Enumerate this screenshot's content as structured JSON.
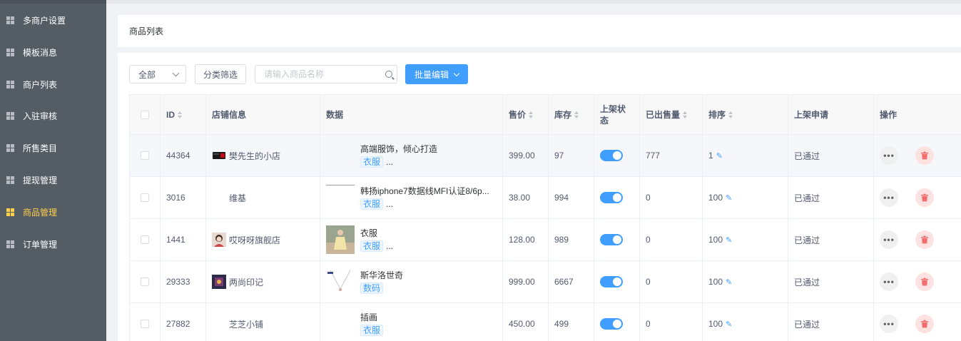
{
  "sidebar": {
    "items": [
      {
        "label": "多商户设置",
        "active": false
      },
      {
        "label": "模板消息",
        "active": false
      },
      {
        "label": "商户列表",
        "active": false
      },
      {
        "label": "入驻审核",
        "active": false
      },
      {
        "label": "所售类目",
        "active": false
      },
      {
        "label": "提现管理",
        "active": false
      },
      {
        "label": "商品管理",
        "active": true
      },
      {
        "label": "订单管理",
        "active": false
      }
    ]
  },
  "page": {
    "title": "商品列表"
  },
  "toolbar": {
    "filter_select": "全部",
    "category_filter": "分类筛选",
    "search_placeholder": "请输入商品名称",
    "batch_edit": "批量编辑"
  },
  "table": {
    "headers": {
      "id": "ID",
      "shop": "店铺信息",
      "data": "数据",
      "price": "售价",
      "stock": "库存",
      "status": "上架状态",
      "sold": "已出售量",
      "sort": "排序",
      "apply": "上架申请",
      "ops": "操作"
    },
    "rows": [
      {
        "id": "44364",
        "shop": "樊先生的小店",
        "name": "高端服饰，倾心打造",
        "tag": "衣服",
        "ellipsis": "...",
        "price": "399.00",
        "stock": "97",
        "on_shelf": true,
        "sold": "777",
        "sort": "1",
        "apply": "已通过"
      },
      {
        "id": "3016",
        "shop": "维基",
        "name": "韩扬iphone7数据线MFI认证8/6p...",
        "tag": "衣服",
        "ellipsis": "...",
        "price": "38.00",
        "stock": "994",
        "on_shelf": true,
        "sold": "0",
        "sort": "100",
        "apply": "已通过"
      },
      {
        "id": "1441",
        "shop": "哎呀呀旗舰店",
        "name": "衣服",
        "tag": "衣服",
        "ellipsis": "...",
        "price": "128.00",
        "stock": "989",
        "on_shelf": true,
        "sold": "0",
        "sort": "100",
        "apply": "已通过"
      },
      {
        "id": "29333",
        "shop": "两尚印记",
        "name": "斯华洛世奇",
        "tag": "数码",
        "ellipsis": "",
        "price": "999.00",
        "stock": "6667",
        "on_shelf": true,
        "sold": "0",
        "sort": "100",
        "apply": "已通过"
      },
      {
        "id": "27882",
        "shop": "芝芝小铺",
        "name": "插画",
        "tag": "衣服",
        "ellipsis": "",
        "price": "450.00",
        "stock": "499",
        "on_shelf": true,
        "sold": "0",
        "sort": "100",
        "apply": "已通过"
      }
    ]
  },
  "colors": {
    "accent": "#409eff",
    "sidebar_bg": "#545c64",
    "active_nav": "#ffd04b",
    "delete": "#f56c6c"
  },
  "icons": {
    "nav": "grid-icon",
    "search": "search-icon",
    "more": "more-icon",
    "delete": "trash-icon",
    "edit": "pencil-icon"
  }
}
